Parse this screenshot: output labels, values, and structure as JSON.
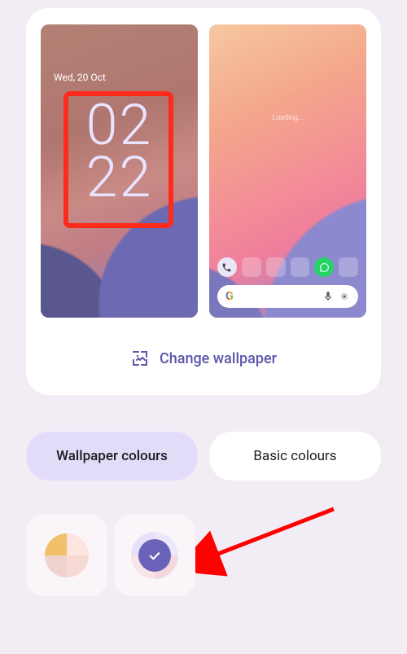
{
  "lockscreen": {
    "date": "Wed, 20 Oct",
    "time_top": "02",
    "time_bottom": "22"
  },
  "homescreen": {
    "loading_text": "Loading...",
    "search_logo": "G"
  },
  "actions": {
    "change_wallpaper": "Change wallpaper"
  },
  "tabs": {
    "wallpaper_colours": "Wallpaper colours",
    "basic_colours": "Basic colours"
  },
  "colors": {
    "accent": "#6a62b9",
    "highlight": "#ff2a1a"
  }
}
